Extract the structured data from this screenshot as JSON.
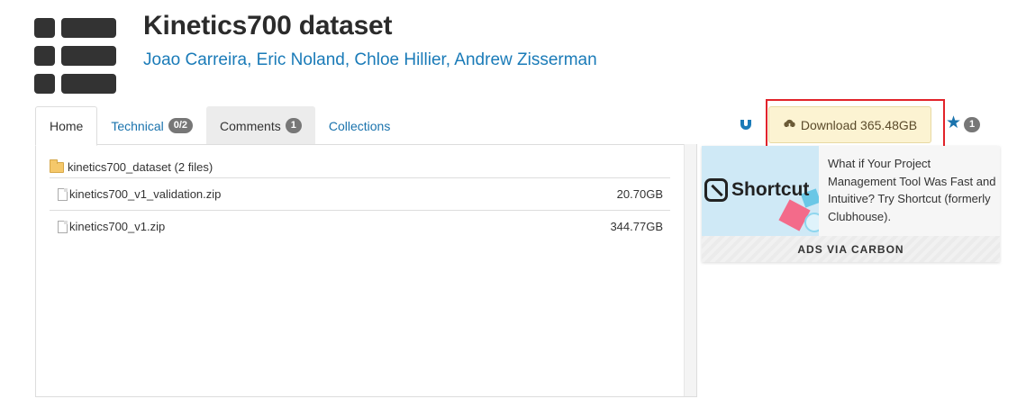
{
  "dataset": {
    "title": "Kinetics700 dataset",
    "authors": "Joao Carreira, Eric Noland, Chloe Hillier, Andrew Zisserman"
  },
  "tabs": [
    {
      "label": "Home",
      "active": true
    },
    {
      "label": "Technical",
      "badge": "0/2"
    },
    {
      "label": "Comments",
      "badge": "1"
    },
    {
      "label": "Collections"
    }
  ],
  "actions": {
    "magnet_icon": "magnet-icon",
    "download_label": "Download 365.48GB",
    "star_count": "1"
  },
  "files": {
    "folder_label": "kinetics700_dataset (2 files)",
    "items": [
      {
        "name": "kinetics700_v1_validation.zip",
        "size": "20.70GB"
      },
      {
        "name": "kinetics700_v1.zip",
        "size": "344.77GB"
      }
    ]
  },
  "ad": {
    "brand": "Shortcut",
    "text": "What if Your Project Management Tool Was Fast and Intuitive? Try Shortcut (formerly Clubhouse).",
    "footer": "ADS VIA CARBON"
  },
  "colors": {
    "link": "#1a7bb8",
    "download_bg": "#fcf3d2",
    "highlight": "#e2232a"
  }
}
